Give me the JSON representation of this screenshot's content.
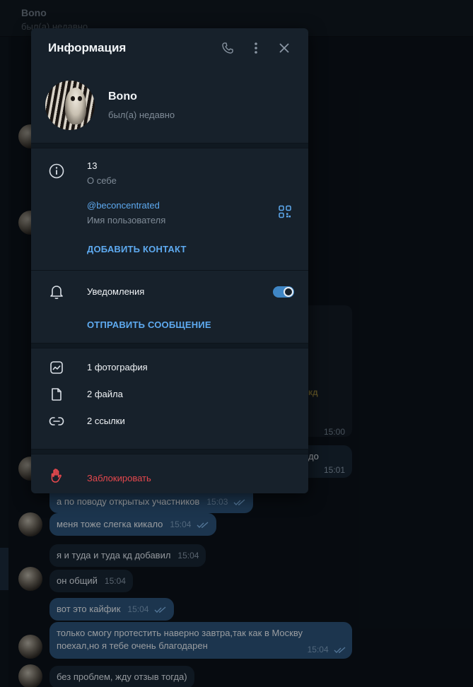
{
  "chat": {
    "name": "Bono",
    "status": "был(а) недавно",
    "messages": [
      {
        "text": "",
        "time": "15:00"
      },
      {
        "text": "до",
        "time": "15:01"
      },
      {
        "text": "а по поводу открытых участников",
        "time": "15:03"
      },
      {
        "text": "меня тоже слегка кикало",
        "time": "15:04"
      },
      {
        "text": "я и туда и туда кд добавил",
        "time": "15:04"
      },
      {
        "text": "он общий",
        "time": "15:04"
      },
      {
        "text": "вот это кайфик",
        "time": "15:04"
      },
      {
        "text_line1": "только смогу протестить наверно завтра,так как в Москву",
        "text_line2": "поехал,но я тебе очень благодарен",
        "time": "15:04"
      },
      {
        "text": "без проблем, жду отзыв тогда)"
      }
    ],
    "media_fragment": "кд"
  },
  "panel": {
    "title": "Информация",
    "profile": {
      "name": "Bono",
      "status": "был(а) недавно"
    },
    "bio": {
      "value": "13",
      "label": "О себе"
    },
    "username": {
      "value": "@beconcentrated",
      "label": "Имя пользователя"
    },
    "add_contact": "ДОБАВИТЬ КОНТАКТ",
    "notifications": {
      "label": "Уведомления",
      "enabled": true
    },
    "send_message": "ОТПРАВИТЬ СООБЩЕНИЕ",
    "media": {
      "photos": "1 фотография",
      "files": "2 файла",
      "links": "2 ссылки"
    },
    "block": "Заблокировать"
  },
  "colors": {
    "accent": "#5eaaf0",
    "danger": "#e5484d",
    "toggle": "#3f86c5",
    "panel_bg": "#17212b"
  }
}
